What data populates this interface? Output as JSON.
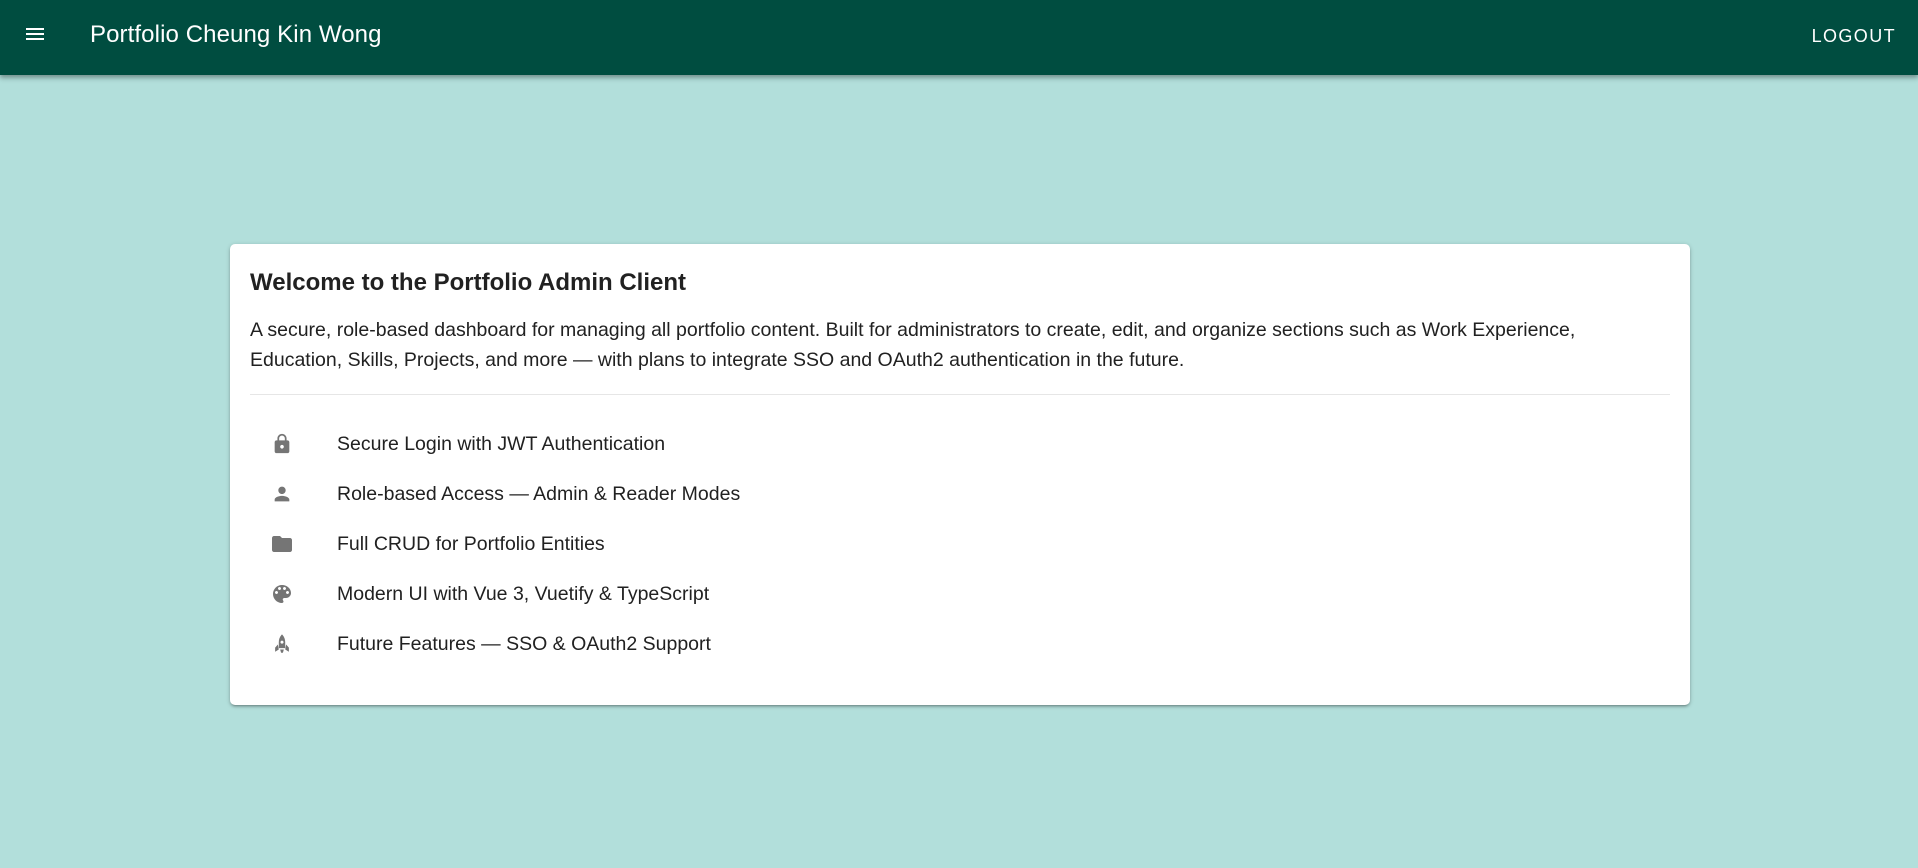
{
  "app_bar": {
    "title": "Portfolio Cheung Kin Wong",
    "menu_icon": "hamburger-menu-icon",
    "logout_label": "LOGOUT",
    "background_color": "#004d40"
  },
  "page": {
    "background_color": "#b2dfdb"
  },
  "card": {
    "title": "Welcome to the Portfolio Admin Client",
    "description": "A secure, role-based dashboard for managing all portfolio content. Built for administrators to create, edit, and organize sections such as Work Experience, Education, Skills, Projects, and more — with plans to integrate SSO and OAuth2 authentication in the future.",
    "features": [
      {
        "icon": "lock-icon",
        "label": "Secure Login with JWT Authentication"
      },
      {
        "icon": "person-icon",
        "label": "Role-based Access — Admin & Reader Modes"
      },
      {
        "icon": "folder-icon",
        "label": "Full CRUD for Portfolio Entities"
      },
      {
        "icon": "palette-icon",
        "label": "Modern UI with Vue 3, Vuetify & TypeScript"
      },
      {
        "icon": "rocket-icon",
        "label": "Future Features — SSO & OAuth2 Support"
      }
    ]
  }
}
